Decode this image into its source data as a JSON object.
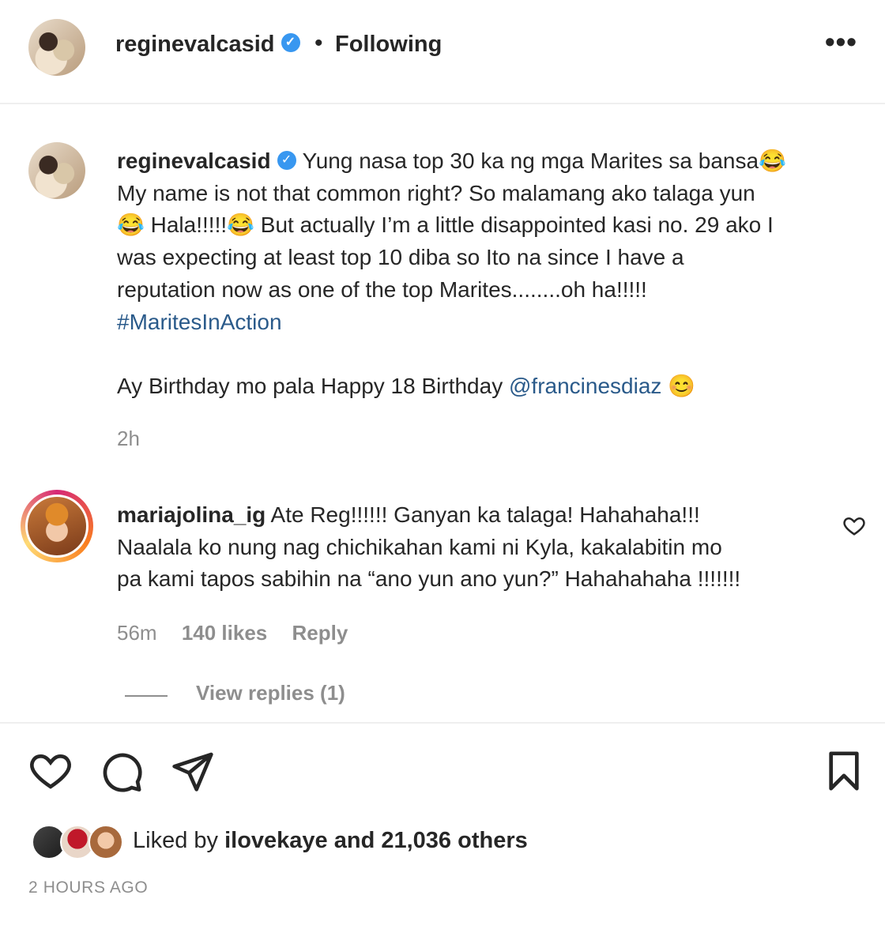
{
  "header": {
    "username": "reginevalcasid",
    "separator": "•",
    "follow_status": "Following",
    "more_icon": "more-horizontal-icon"
  },
  "caption": {
    "username": "reginevalcasid",
    "line1": "Yung nasa top 30 ka ng mga Marites sa bansa😂",
    "line2": "My name is not that common right? So malamang ako talaga yun",
    "line3": "😂 Hala!!!!!😂 But actually I’m a little disappointed kasi no. 29 ako I",
    "line4": "was expecting at least top 10 diba so Ito na since I have a",
    "line5": "reputation now as one of the top Marites........oh ha!!!!!",
    "hashtag": "#MaritesInAction",
    "birthday_text": "Ay Birthday mo pala Happy 18 Birthday",
    "mention": "@francinesdiaz",
    "emoji_end": "😊",
    "time": "2h"
  },
  "comment": {
    "username": "mariajolina_ig",
    "line1": "Ate Reg!!!!!! Ganyan ka talaga! Hahahaha!!!",
    "line2": "Naalala ko nung nag chichikahan kami ni Kyla, kakalabitin mo",
    "line3": "pa kami tapos sabihin na “ano yun ano yun?” Hahahahaha !!!!!!!",
    "time": "56m",
    "likes": "140 likes",
    "reply_label": "Reply",
    "view_replies": "View replies (1)"
  },
  "actions": {
    "like_icon": "heart-icon",
    "comment_icon": "comment-icon",
    "share_icon": "send-icon",
    "save_icon": "bookmark-icon"
  },
  "likes": {
    "prefix": "Liked by",
    "user": "ilovekaye",
    "suffix": "and 21,036 others"
  },
  "post_time": "2 HOURS AGO",
  "colors": {
    "verified": "#3897f0",
    "link": "#2a5a8a",
    "muted": "#8e8e8e",
    "text": "#262626"
  }
}
